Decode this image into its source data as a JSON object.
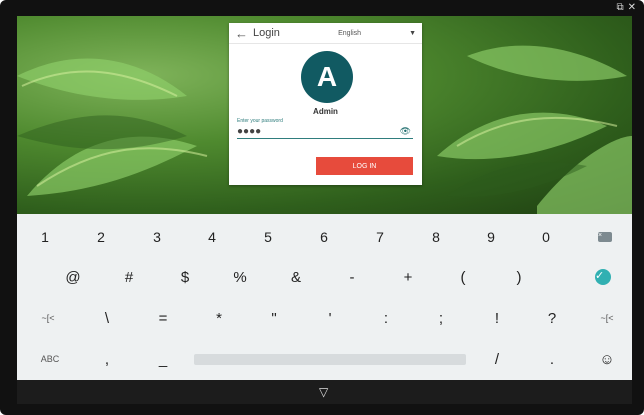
{
  "window": {
    "controls": [
      "⧉",
      "✕"
    ]
  },
  "login": {
    "title": "Login",
    "language": "English",
    "avatar_initial": "A",
    "username": "Admin",
    "password_label": "Enter your password",
    "password_mask": "●●●●",
    "button_label": "LOG IN"
  },
  "keyboard": {
    "rows": [
      [
        "1",
        "2",
        "3",
        "4",
        "5",
        "6",
        "7",
        "8",
        "9",
        "0"
      ],
      [
        "@",
        "#",
        "$",
        "%",
        "&",
        "-",
        "+",
        "(",
        ")"
      ],
      [
        "~[<",
        "\\",
        "=",
        "*",
        "\"",
        "'",
        ":",
        ";",
        "!",
        "?",
        "~[<"
      ],
      [
        "ABC",
        ",",
        "_",
        "/",
        ".",
        "☺"
      ]
    ]
  }
}
